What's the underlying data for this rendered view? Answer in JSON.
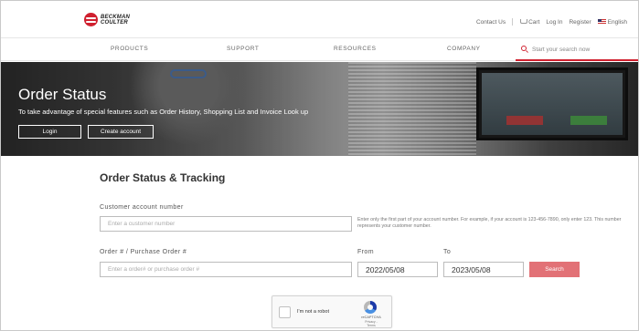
{
  "header": {
    "logo_line1": "BECKMAN",
    "logo_line2": "COULTER",
    "utility": {
      "contact": "Contact Us",
      "cart": "Cart",
      "login": "Log In",
      "register": "Register",
      "language": "English"
    }
  },
  "nav": {
    "items": [
      "PRODUCTS",
      "SUPPORT",
      "RESOURCES",
      "COMPANY"
    ],
    "search_placeholder": "Start your search now"
  },
  "hero": {
    "title": "Order Status",
    "subtitle": "To take advantage of special features such as Order History, Shopping List and Invoice Look up",
    "login_label": "Login",
    "create_label": "Create account"
  },
  "form": {
    "title": "Order Status & Tracking",
    "account_label": "Customer account number",
    "account_placeholder": "Enter a customer number",
    "account_hint": "Enter only the first part of your account number. For example, if your account is 123-456-7890, only enter 123. This number represents your customer number.",
    "order_label": "Order # / Purchase Order #",
    "order_placeholder": "Enter a order# or purchase order #",
    "from_label": "From",
    "from_value": "2022/05/08",
    "to_label": "To",
    "to_value": "2023/05/08",
    "search_label": "Search"
  },
  "captcha": {
    "label": "I'm not a robot",
    "brand": "reCAPTCHA",
    "terms": "Privacy - Terms"
  },
  "colors": {
    "brand_red": "#d0202f",
    "search_button": "#e27176"
  }
}
